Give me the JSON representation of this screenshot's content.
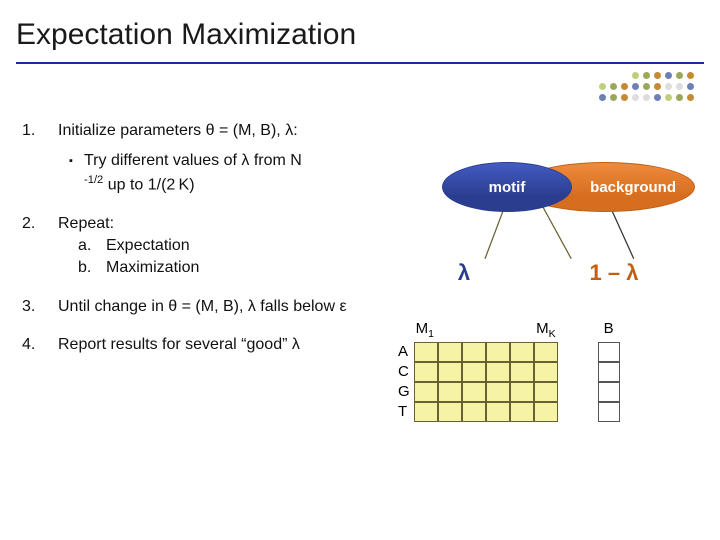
{
  "title": "Expectation Maximization",
  "steps": {
    "s1": {
      "num": "1.",
      "text": "Initialize parameters θ = (M, B), λ:"
    },
    "s1a": {
      "bullet": "▪",
      "line1": "Try different values of λ from N",
      "supexp": "-1/2",
      "line2": " up to 1/(2 K)"
    },
    "s2": {
      "num": "2.",
      "lead": "Repeat:",
      "a": {
        "lbl": "a.",
        "txt": "Expectation"
      },
      "b": {
        "lbl": "b.",
        "txt": "Maximization"
      }
    },
    "s3": {
      "num": "3.",
      "text": "Until change in θ = (M, B), λ falls below ε"
    },
    "s4": {
      "num": "4.",
      "text": "Report results for several “good” λ"
    }
  },
  "diagram": {
    "motif_label": "motif",
    "background_label": "background",
    "lambda": "λ",
    "one_minus_lambda": "1 – λ"
  },
  "matrices": {
    "rows": [
      "A",
      "C",
      "G",
      "T"
    ],
    "m1": "M",
    "m1sub": "1",
    "mK": "M",
    "mKsub": "K",
    "B": "B"
  },
  "chart_data": {
    "type": "table",
    "title": "EM motif/background model sketch",
    "motif_matrix": {
      "rows": [
        "A",
        "C",
        "G",
        "T"
      ],
      "columns": 6,
      "label_first": "M1",
      "label_last": "MK"
    },
    "background_matrix": {
      "rows": [
        "A",
        "C",
        "G",
        "T"
      ],
      "columns": 1,
      "label": "B"
    },
    "mixture": {
      "motif_weight": "λ",
      "background_weight": "1-λ"
    }
  },
  "dot_colors": {
    "a": "#6d7fb3",
    "b": "#9aa85a",
    "c": "#c58a33",
    "d": "#ddd",
    "e": "#bfcf7a"
  }
}
